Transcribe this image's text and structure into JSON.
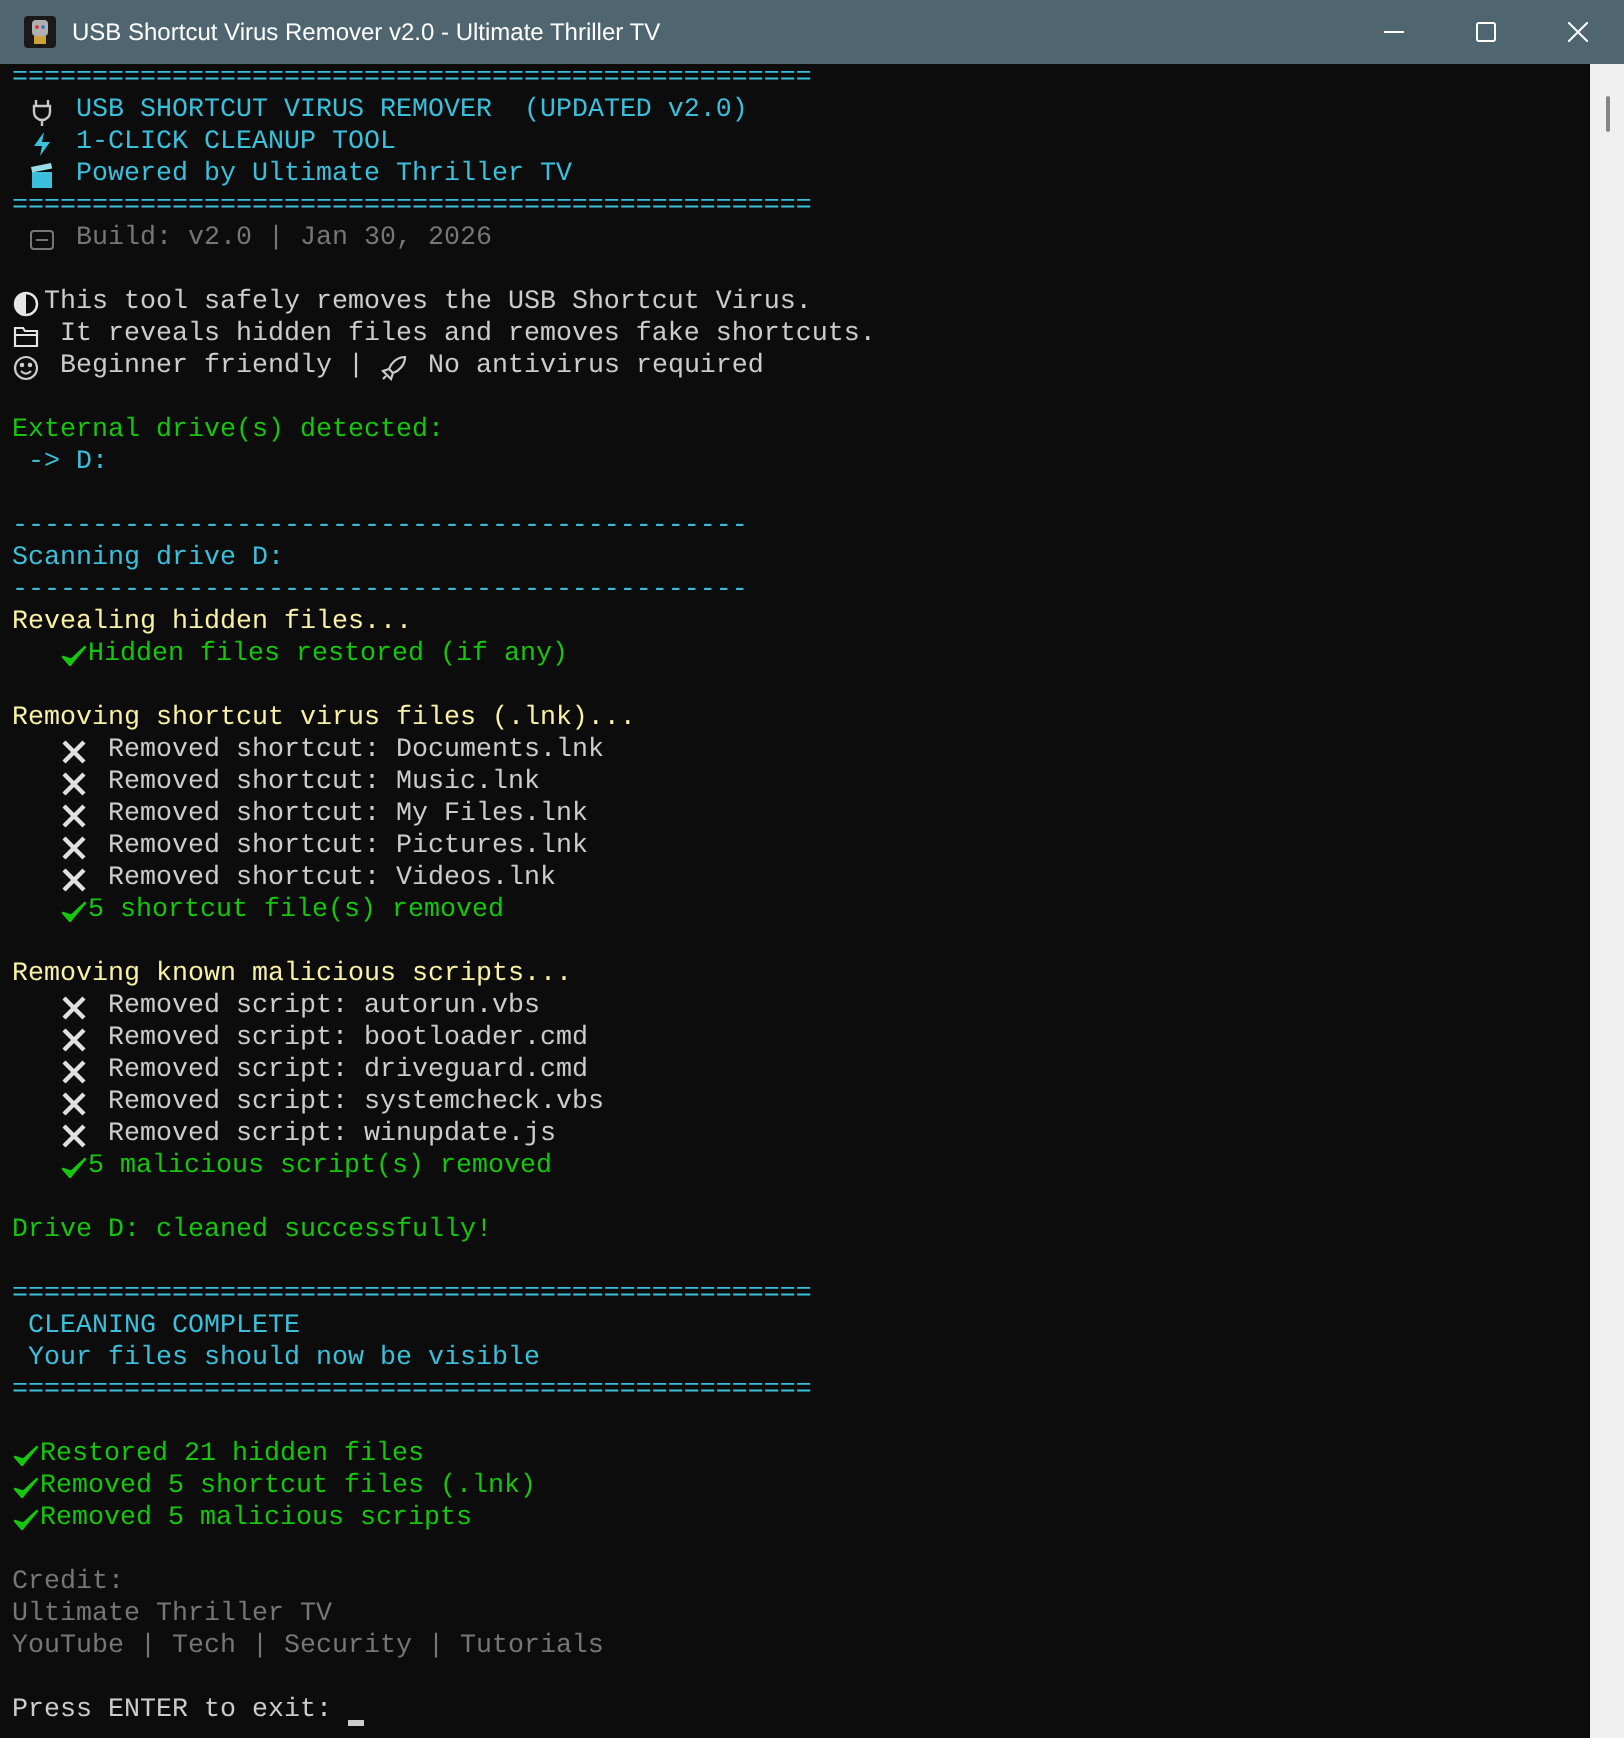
{
  "window": {
    "title": "USB Shortcut Virus Remover v2.0 - Ultimate Thriller TV"
  },
  "console": {
    "lines": [
      {
        "kind": "rule",
        "color": "#3bc0dc",
        "text": "=================================================="
      },
      {
        "kind": "banner",
        "color": "#3bc0dc",
        "parts": [
          {
            "kind": "plug"
          },
          {
            "text": "USB SHORTCUT VIRUS REMOVER  (UPDATED v2.0)"
          }
        ]
      },
      {
        "kind": "banner",
        "color": "#3bc0dc",
        "parts": [
          {
            "kind": "bolt"
          },
          {
            "text": "1-CLICK CLEANUP TOOL"
          }
        ]
      },
      {
        "kind": "banner",
        "color": "#3bc0dc",
        "parts": [
          {
            "kind": "clapper"
          },
          {
            "text": "Powered by Ultimate Thriller TV"
          }
        ]
      },
      {
        "kind": "rule",
        "color": "#3bc0dc",
        "text": "=================================================="
      },
      {
        "kind": "banner",
        "color": "#767676",
        "parts": [
          {
            "kind": "badge"
          },
          {
            "text": "Build: v2.0 | Jan 30, 2026"
          }
        ]
      },
      {
        "kind": "blank"
      },
      {
        "kind": "text",
        "color": "#cccccc",
        "parts": [
          {
            "kind": "moon"
          },
          {
            "text": "This tool safely removes the USB Shortcut Virus."
          }
        ]
      },
      {
        "kind": "text",
        "color": "#cccccc",
        "parts": [
          {
            "kind": "folder"
          },
          {
            "text": " It reveals hidden files and removes fake shortcuts."
          }
        ]
      },
      {
        "kind": "text",
        "color": "#cccccc",
        "parts": [
          {
            "kind": "smiley"
          },
          {
            "text": " Beginner friendly | "
          },
          {
            "kind": "rocket"
          },
          {
            "text": " No antivirus required"
          }
        ]
      },
      {
        "kind": "blank"
      },
      {
        "kind": "text",
        "color": "#16c60c",
        "parts": [
          {
            "text": "External drive(s) detected:"
          }
        ]
      },
      {
        "kind": "text",
        "color": "#3bc0dc",
        "parts": [
          {
            "text": " -> D:"
          }
        ]
      },
      {
        "kind": "blank"
      },
      {
        "kind": "rule",
        "color": "#3bc0dc",
        "text": "----------------------------------------------"
      },
      {
        "kind": "text",
        "color": "#3bc0dc",
        "parts": [
          {
            "text": "Scanning drive D:"
          }
        ]
      },
      {
        "kind": "rule",
        "color": "#3bc0dc",
        "text": "----------------------------------------------"
      },
      {
        "kind": "text",
        "color": "#f9f1a5",
        "parts": [
          {
            "text": "Revealing hidden files..."
          }
        ],
        "children": [
          {
            "kind": "check",
            "color": "#16c60c",
            "text": "Hidden files restored (if any)"
          }
        ]
      },
      {
        "kind": "blank"
      },
      {
        "kind": "text",
        "color": "#f9f1a5",
        "parts": [
          {
            "text": "Removing shortcut virus files (.lnk)..."
          }
        ],
        "children": [
          {
            "kind": "cross",
            "color": "#cccccc",
            "text": "Removed shortcut: Documents.lnk"
          },
          {
            "kind": "cross",
            "color": "#cccccc",
            "text": "Removed shortcut: Music.lnk"
          },
          {
            "kind": "cross",
            "color": "#cccccc",
            "text": "Removed shortcut: My Files.lnk"
          },
          {
            "kind": "cross",
            "color": "#cccccc",
            "text": "Removed shortcut: Pictures.lnk"
          },
          {
            "kind": "cross",
            "color": "#cccccc",
            "text": "Removed shortcut: Videos.lnk"
          },
          {
            "kind": "check",
            "color": "#16c60c",
            "text": "5 shortcut file(s) removed"
          }
        ]
      },
      {
        "kind": "blank"
      },
      {
        "kind": "text",
        "color": "#f9f1a5",
        "parts": [
          {
            "text": "Removing known malicious scripts..."
          }
        ],
        "children": [
          {
            "kind": "cross",
            "color": "#cccccc",
            "text": "Removed script: autorun.vbs"
          },
          {
            "kind": "cross",
            "color": "#cccccc",
            "text": "Removed script: bootloader.cmd"
          },
          {
            "kind": "cross",
            "color": "#cccccc",
            "text": "Removed script: driveguard.cmd"
          },
          {
            "kind": "cross",
            "color": "#cccccc",
            "text": "Removed script: systemcheck.vbs"
          },
          {
            "kind": "cross",
            "color": "#cccccc",
            "text": "Removed script: winupdate.js"
          },
          {
            "kind": "check",
            "color": "#16c60c",
            "text": "5 malicious script(s) removed"
          }
        ]
      },
      {
        "kind": "blank"
      },
      {
        "kind": "text",
        "color": "#16c60c",
        "parts": [
          {
            "text": "Drive D: cleaned successfully!"
          }
        ]
      },
      {
        "kind": "blank"
      },
      {
        "kind": "rule",
        "color": "#3bc0dc",
        "text": "=================================================="
      },
      {
        "kind": "text",
        "color": "#3bc0dc",
        "parts": [
          {
            "text": " CLEANING COMPLETE"
          }
        ]
      },
      {
        "kind": "text",
        "color": "#3bc0dc",
        "parts": [
          {
            "text": " Your files should now be visible"
          }
        ]
      },
      {
        "kind": "rule",
        "color": "#3bc0dc",
        "text": "=================================================="
      },
      {
        "kind": "blank"
      },
      {
        "kind": "check",
        "color": "#16c60c",
        "text": "Restored 21 hidden files"
      },
      {
        "kind": "check",
        "color": "#16c60c",
        "text": "Removed 5 shortcut files (.lnk)"
      },
      {
        "kind": "check",
        "color": "#16c60c",
        "text": "Removed 5 malicious scripts"
      },
      {
        "kind": "blank"
      },
      {
        "kind": "text",
        "color": "#767676",
        "parts": [
          {
            "text": "Credit:"
          }
        ]
      },
      {
        "kind": "text",
        "color": "#767676",
        "parts": [
          {
            "text": "Ultimate Thriller TV"
          }
        ]
      },
      {
        "kind": "text",
        "color": "#767676",
        "parts": [
          {
            "text": "YouTube | Tech | Security | Tutorials"
          }
        ]
      },
      {
        "kind": "blank"
      },
      {
        "kind": "prompt",
        "color": "#cccccc",
        "text": "Press ENTER to exit: "
      }
    ]
  }
}
